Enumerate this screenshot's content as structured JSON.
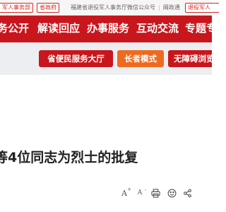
{
  "topbar": {
    "tag_left": "军人事务部",
    "tag_gov": "省政府",
    "wechat_label": "福建省退役军人事务厅微信公众号",
    "separator": "|",
    "mintong_label": "闽政通",
    "tag_right": "退役军人"
  },
  "nav": {
    "items": [
      {
        "label": "务公开"
      },
      {
        "label": "解读回应"
      },
      {
        "label": "办事服务"
      },
      {
        "label": "互动交流"
      },
      {
        "label": "专题专"
      }
    ]
  },
  "services": {
    "hall_label": "省便民服务大厅",
    "elderly_label": "长者模式",
    "accessible_label": "无障碍浏览"
  },
  "article": {
    "title": "等4位同志为烈士的批复"
  },
  "toolbar": {
    "font_up_glyph": "A",
    "font_up_sign": "+",
    "font_down_glyph": "A",
    "font_down_sign": "-"
  },
  "colors": {
    "brand_red": "#c8161d",
    "elderly_orange": "#ee6a1f",
    "strip_bg": "#eceef1"
  },
  "icons": [
    "print-icon",
    "eye-care-icon",
    "share-icon"
  ]
}
